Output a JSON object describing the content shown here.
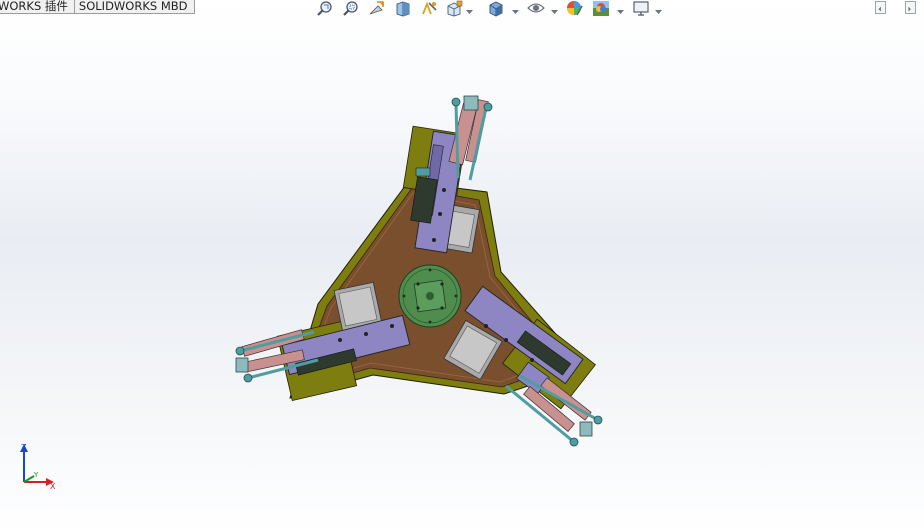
{
  "command_tabs": [
    "WORKS 插件",
    "SOLIDWORKS MBD"
  ],
  "heads_up_toolbar": {
    "tools": [
      "zoom-to-fit",
      "zoom-to-area",
      "previous-view",
      "section-view",
      "dynamic-annotation-views",
      "view-orientation",
      "display-style",
      "hide-show-items",
      "edit-appearance",
      "apply-scene",
      "view-settings"
    ]
  },
  "viewport_controls": [
    "restore",
    "maximize"
  ],
  "triad": {
    "z": "Z",
    "y": "Y",
    "x": "X"
  },
  "colors": {
    "base_plate_outline": "#7d7d10",
    "base_plate_fill": "#7a4f2e",
    "rotary_table": "#4f8d4f",
    "linear_module": "#8d86c2",
    "cylinder_rod": "#4f9da0",
    "gripper_arm": "#c99090",
    "rail_block": "#a9a9a9"
  }
}
